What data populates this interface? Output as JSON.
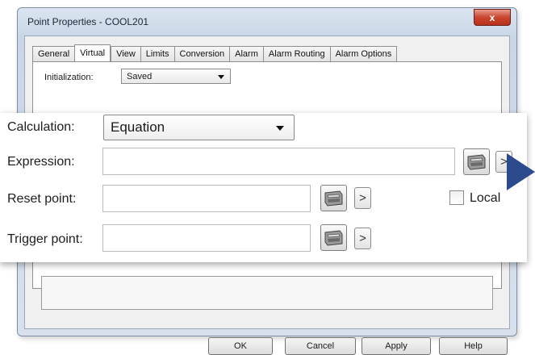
{
  "window": {
    "title": "Point Properties - COOL201",
    "close_glyph": "x"
  },
  "tabs": [
    {
      "label": "General",
      "active": false
    },
    {
      "label": "Virtual",
      "active": true
    },
    {
      "label": "View",
      "active": false
    },
    {
      "label": "Limits",
      "active": false
    },
    {
      "label": "Conversion",
      "active": false
    },
    {
      "label": "Alarm",
      "active": false
    },
    {
      "label": "Alarm Routing",
      "active": false
    },
    {
      "label": "Alarm Options",
      "active": false
    }
  ],
  "initialization": {
    "label": "Initialization:",
    "value": "Saved"
  },
  "zoom": {
    "calculation": {
      "label": "Calculation:",
      "value": "Equation"
    },
    "expression": {
      "label": "Expression:",
      "value": ""
    },
    "reset_point": {
      "label": "Reset point:",
      "value": ""
    },
    "trigger_point": {
      "label": "Trigger point:",
      "value": ""
    },
    "local": {
      "label": "Local",
      "checked": false
    },
    "browse_arrow": ">"
  },
  "buttons": {
    "ok": "OK",
    "cancel": "Cancel",
    "apply": "Apply",
    "help": "Help"
  },
  "icons": {
    "picker": "point-browser-icon",
    "pointer": "callout-arrow-icon"
  },
  "colors": {
    "close_button": "#c9452e",
    "callout_arrow": "#2c4a8e"
  }
}
